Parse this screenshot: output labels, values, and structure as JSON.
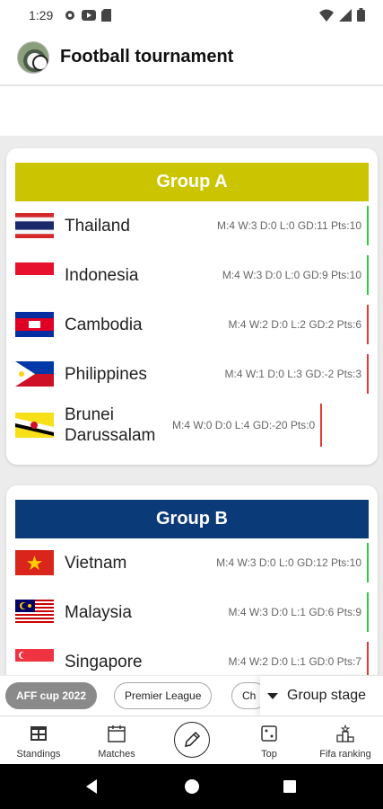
{
  "status_bar": {
    "time": "1:29",
    "left_icons": [
      "gear-icon",
      "youtube-icon",
      "sim-card-icon"
    ],
    "right_icons": [
      "wifi-icon",
      "signal-icon",
      "battery-icon"
    ]
  },
  "app_bar": {
    "title": "Football tournament",
    "avatar_icon": "soccer-ball-avatar"
  },
  "groups": [
    {
      "name": "Group A",
      "header_color": "#cbc400",
      "teams": [
        {
          "name": "Thailand",
          "stats": "M:4 W:3 D:0 L:0 GD:11 Pts:10",
          "flag": "thailand",
          "qualified": true
        },
        {
          "name": "Indonesia",
          "stats": "M:4 W:3 D:0 L:0 GD:9 Pts:10",
          "flag": "indonesia",
          "qualified": true
        },
        {
          "name": "Cambodia",
          "stats": "M:4 W:2 D:0 L:2 GD:2 Pts:6",
          "flag": "cambodia",
          "qualified": false
        },
        {
          "name": "Philippines",
          "stats": "M:4 W:1 D:0 L:3 GD:-2 Pts:3",
          "flag": "philippines",
          "qualified": false
        },
        {
          "name": "Brunei Darussalam",
          "stats": "M:4 W:0 D:0 L:4 GD:-20 Pts:0",
          "flag": "brunei",
          "qualified": false
        }
      ]
    },
    {
      "name": "Group B",
      "header_color": "#0b3a78",
      "teams": [
        {
          "name": "Vietnam",
          "stats": "M:4 W:3 D:0 L:0 GD:12 Pts:10",
          "flag": "vietnam",
          "qualified": true
        },
        {
          "name": "Malaysia",
          "stats": "M:4 W:3 D:0 L:1 GD:6 Pts:9",
          "flag": "malaysia",
          "qualified": true
        },
        {
          "name": "Singapore",
          "stats": "M:4 W:2 D:0 L:1 GD:0 Pts:7",
          "flag": "singapore",
          "qualified": false
        }
      ]
    }
  ],
  "colors": {
    "qualified": "#2ecc40",
    "eliminated": "#e53935"
  },
  "filters": {
    "chips": [
      "AFF cup 2022",
      "Premier League",
      "Ch"
    ],
    "active": "AFF cup 2022",
    "stage_label": "Group stage"
  },
  "bottom_nav": {
    "items": [
      {
        "label": "Standings",
        "icon": "table-icon"
      },
      {
        "label": "Matches",
        "icon": "calendar-icon"
      },
      {
        "label": "",
        "icon": "pencil-icon"
      },
      {
        "label": "Top",
        "icon": "dice-icon"
      },
      {
        "label": "Fifa ranking",
        "icon": "podium-icon"
      }
    ]
  }
}
